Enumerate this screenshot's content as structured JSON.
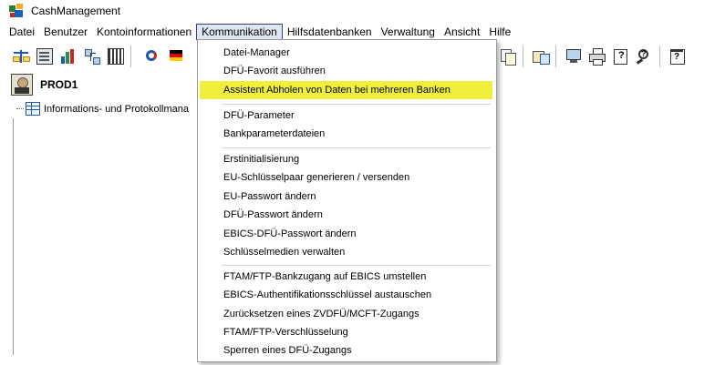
{
  "window": {
    "title": "CashManagement"
  },
  "menubar": {
    "items": [
      {
        "label": "Datei"
      },
      {
        "label": "Benutzer"
      },
      {
        "label": "Kontoinformationen"
      },
      {
        "label": "Kommunikation",
        "active": true
      },
      {
        "label": "Hilfsdatenbanken"
      },
      {
        "label": "Verwaltung"
      },
      {
        "label": "Ansicht"
      },
      {
        "label": "Hilfe"
      }
    ]
  },
  "toolbar": {
    "buttons": [
      "scales-icon",
      "form-icon",
      "chart-icon",
      "network-icon",
      "barcode-icon",
      "refresh-icon",
      "flag-icon",
      "copy-icon",
      "transfer-icon",
      "monitor-icon",
      "printer-icon",
      "help-doc-icon",
      "help-search-icon",
      "help-window-icon"
    ]
  },
  "profile": {
    "name": "PROD1"
  },
  "tree": {
    "root_label": "Informations- und Protokollmana"
  },
  "dropdown": {
    "groups": [
      [
        {
          "label": "Datei-Manager"
        },
        {
          "label": "DFÜ-Favorit ausführen"
        },
        {
          "label": "Assistent Abholen von Daten bei mehreren Banken",
          "highlighted": true
        }
      ],
      [
        {
          "label": "DFÜ-Parameter"
        },
        {
          "label": "Bankparameterdateien"
        }
      ],
      [
        {
          "label": "Erstinitialisierung"
        },
        {
          "label": "EU-Schlüsselpaar generieren / versenden"
        },
        {
          "label": "EU-Passwort ändern"
        },
        {
          "label": "DFÜ-Passwort ändern"
        },
        {
          "label": "EBICS-DFÜ-Passwort ändern"
        },
        {
          "label": "Schlüsselmedien verwalten"
        }
      ],
      [
        {
          "label": "FTAM/FTP-Bankzugang auf EBICS umstellen"
        },
        {
          "label": "EBICS-Authentifikationsschlüssel austauschen"
        },
        {
          "label": "Zurücksetzen eines ZVDFÜ/MCFT-Zugangs"
        },
        {
          "label": "FTAM/FTP-Verschlüsselung"
        },
        {
          "label": "Sperren eines DFÜ-Zugangs"
        }
      ]
    ],
    "highlight_color": "#f0f03c"
  }
}
